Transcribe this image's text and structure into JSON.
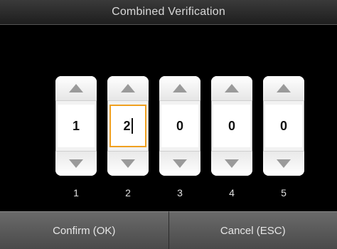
{
  "window": {
    "title": "Combined Verification"
  },
  "spinners": [
    {
      "value": "1",
      "label": "1"
    },
    {
      "value": "2",
      "label": "2"
    },
    {
      "value": "0",
      "label": "3"
    },
    {
      "value": "0",
      "label": "4"
    },
    {
      "value": "0",
      "label": "5"
    }
  ],
  "buttons": {
    "confirm_label": "Confirm (OK)",
    "cancel_label": "Cancel (ESC)"
  },
  "colors": {
    "active_border": "#f0a020",
    "background": "#000000"
  },
  "icons": {
    "increment": "triangle-up-icon",
    "decrement": "triangle-down-icon"
  }
}
